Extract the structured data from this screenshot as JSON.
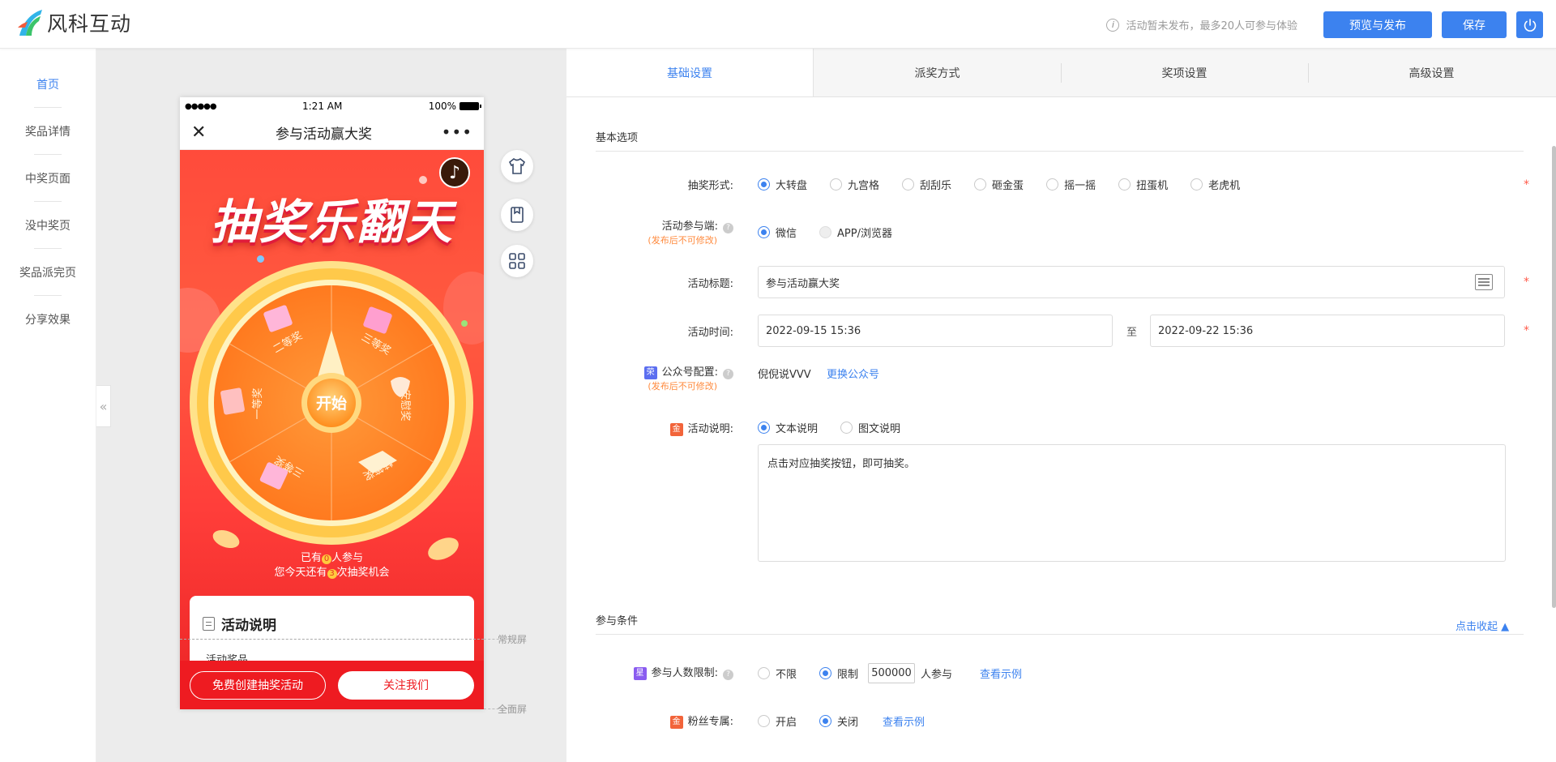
{
  "brand": {
    "name": "风科互动"
  },
  "header": {
    "notice": "活动暂未发布，最多20人可参与体验",
    "preview_publish": "预览与发布",
    "save": "保存"
  },
  "sidenav": {
    "items": [
      {
        "label": "首页",
        "active": true
      },
      {
        "label": "奖品详情"
      },
      {
        "label": "中奖页面"
      },
      {
        "label": "没中奖页"
      },
      {
        "label": "奖品派完页"
      },
      {
        "label": "分享效果"
      }
    ]
  },
  "phone": {
    "status": {
      "time": "1:21 AM",
      "battery": "100%",
      "signal": "●●●●●"
    },
    "title": "参与活动赢大奖",
    "headline": "抽奖乐翻天",
    "wheel": {
      "center": "开始",
      "segments": [
        "三等奖",
        "安慰奖",
        "特等奖",
        "三等奖",
        "一等奖",
        "二等奖"
      ]
    },
    "participants_prefix": "已有",
    "participants_count": "0",
    "participants_suffix": "人参与",
    "chances_prefix": "您今天还有",
    "chances_count": "3",
    "chances_suffix": "次抽奖机会",
    "desc_title": "活动说明",
    "desc_sub": "活动奖品",
    "btn_create": "免费创建抽奖活动",
    "btn_follow": "关注我们"
  },
  "markers": {
    "normal": "常规屏",
    "full": "全面屏"
  },
  "tabs": [
    "基础设置",
    "派奖方式",
    "奖项设置",
    "高级设置"
  ],
  "basic": {
    "section_title": "基本选项",
    "lottery_form": {
      "label": "抽奖形式:",
      "options": [
        "大转盘",
        "九宫格",
        "刮刮乐",
        "砸金蛋",
        "摇一摇",
        "扭蛋机",
        "老虎机"
      ],
      "selected": "大转盘"
    },
    "platform": {
      "label": "活动参与端:",
      "note": "(发布后不可修改)",
      "options": [
        "微信",
        "APP/浏览器"
      ],
      "selected": "微信"
    },
    "title_field": {
      "label": "活动标题:",
      "value": "参与活动赢大奖"
    },
    "time": {
      "label": "活动时间:",
      "start": "2022-09-15 15:36",
      "sep": "至",
      "end": "2022-09-22 15:36"
    },
    "official": {
      "badge": "荣",
      "label": "公众号配置:",
      "note": "(发布后不可修改)",
      "value": "倪倪说VVV",
      "change": "更换公众号"
    },
    "desc": {
      "badge": "金",
      "label": "活动说明:",
      "options": [
        "文本说明",
        "图文说明"
      ],
      "selected": "文本说明",
      "text": "点击对应抽奖按钮，即可抽奖。"
    }
  },
  "conditions": {
    "section_title": "参与条件",
    "collapse": "点击收起",
    "limit": {
      "badge": "星",
      "label": "参与人数限制:",
      "options": [
        "不限",
        "限制"
      ],
      "selected": "限制",
      "value": "500000",
      "suffix": "人参与",
      "example": "查看示例"
    },
    "fans": {
      "badge": "金",
      "label": "粉丝专属:",
      "options": [
        "开启",
        "关闭"
      ],
      "selected": "关闭",
      "example": "查看示例"
    }
  },
  "colors": {
    "accent": "#3c82ef",
    "hero_red": "#ff4b3b",
    "bottom_red": "#ee1b21",
    "required": "#ff5a4a"
  }
}
